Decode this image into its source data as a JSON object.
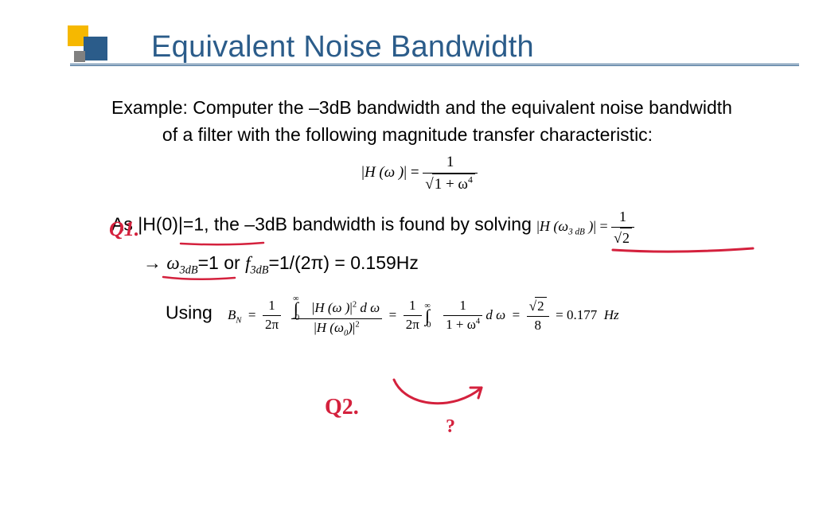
{
  "title": "Equivalent Noise Bandwidth",
  "example": {
    "line1": "Example: Computer the –3dB bandwidth and the equivalent noise bandwidth",
    "line2": "of a filter with the following magnitude transfer characteristic:"
  },
  "eq_transfer": {
    "lhs_abs": "H (ω )",
    "eq": "=",
    "num": "1",
    "den_prefix": "1 + ω",
    "den_power": "4"
  },
  "solving": {
    "prefix": "As ",
    "cond": "|H(0)|=1,",
    "mid": " the –3dB bandwidth is found by solving  ",
    "lhs_abs": "H (ω",
    "lhs_sub": "3 dB",
    "lhs_close": " )",
    "eq": "=",
    "num": "1",
    "den": "2"
  },
  "result_3db": {
    "arrow": "→",
    "text_a": "ω",
    "text_a_sub": "3dB",
    "text_b": "=1   or ",
    "text_c": "f",
    "text_c_sub": "3dB",
    "text_d": "=1/(2π) = 0.159Hz"
  },
  "bn": {
    "using": "Using",
    "lhs": "B",
    "lhs_sub": "N",
    "eq1": "=",
    "pre_frac": "1",
    "pre_den": "2π",
    "int_top": "∞",
    "int_bot": "0",
    "integrand_abs": "H (ω )",
    "integrand_pow": "2",
    "d_omega": "d ω",
    "denom_abs": "H (ω",
    "denom_sub": "0",
    "denom_close": ")",
    "denom_pow": "2",
    "eq2": "=",
    "mid_pre_num": "1",
    "mid_pre_den": "2π",
    "mid_int_top": "∞",
    "mid_int_bot": "0",
    "mid_frac_num": "1",
    "mid_frac_den_a": "1 + ω",
    "mid_frac_den_pow": "4",
    "mid_d": "d ω",
    "eq3": "=",
    "res_num": "2",
    "res_den": "8",
    "eq4": "=",
    "val": "0.177",
    "unit": "Hz"
  },
  "annotations": {
    "q1": "Q1.",
    "q2": "Q2.",
    "qmark": "?"
  },
  "colors": {
    "heading": "#2b5c8a",
    "accent_yellow": "#f6b800",
    "accent_blue": "#2b5c8a",
    "accent_red": "#d4213d"
  }
}
